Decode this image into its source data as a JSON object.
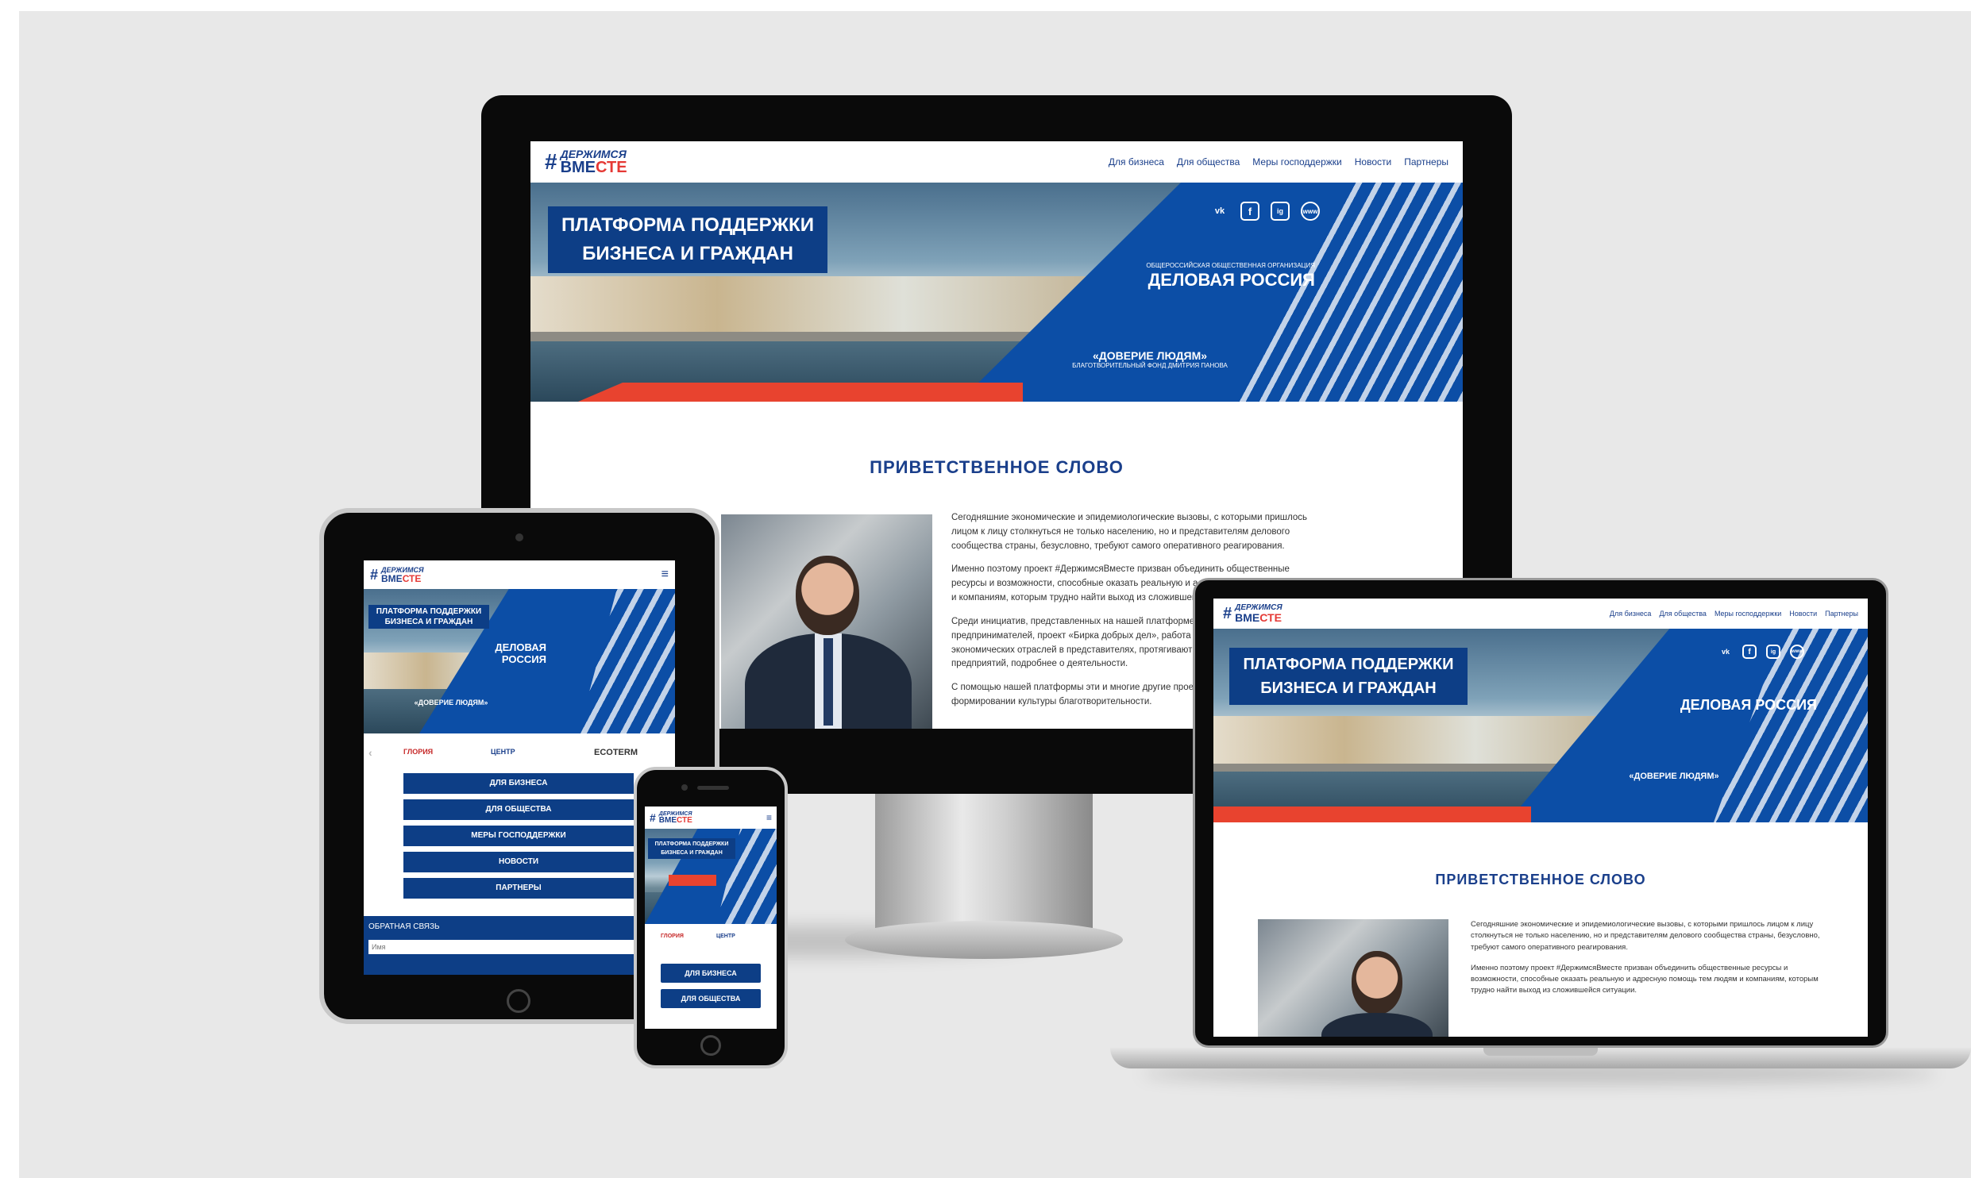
{
  "site": {
    "logo_line1": "ДЕРЖИМСЯ",
    "logo_line2a": "ВМЕ",
    "logo_line2b": "СТЕ",
    "logo_hash": "#",
    "nav": [
      "Для бизнеса",
      "Для общества",
      "Меры господдержки",
      "Новости",
      "Партнеры"
    ]
  },
  "banner": {
    "title_line1": "ПЛАТФОРМА ПОДДЕРЖКИ",
    "title_line2": "БИЗНЕСА И ГРАЖДАН",
    "org1_small": "ОБЩЕРОССИЙСКАЯ ОБЩЕСТВЕННАЯ ОРГАНИЗАЦИЯ",
    "org1_big": "ДЕЛОВАЯ РОССИЯ",
    "org2_big": "«ДОВЕРИЕ ЛЮДЯМ»",
    "org2_small": "БЛАГОТВОРИТЕЛЬНЫЙ ФОНД ДМИТРИЯ ПАНОВА",
    "social": [
      "vk",
      "f",
      "ig",
      "www"
    ],
    "social_icon_names": [
      "vk-icon",
      "facebook-icon",
      "instagram-icon",
      "globe-icon"
    ]
  },
  "welcome": {
    "heading": "ПРИВЕТСТВЕННОЕ СЛОВО",
    "p1": "Сегодняшние экономические и эпидемиологические вызовы, с которыми пришлось лицом к лицу столкнуться не только населению, но и представителям делового сообщества страны, безусловно, требуют самого оперативного реагирования.",
    "p2": "Именно поэтому проект #ДержимсяВместе призван объединить общественные ресурсы и возможности, способные оказать реальную и адресную помощь тем людям и компаниям, которым трудно найти выход из сложившейся ситуации.",
    "p3": "Среди инициатив, представленных на нашей платформе – программы поддержки предпринимателей, проект «Бирка добрых дел», работа наиболее пострадавших экономических отраслей в представителях, протягивают руку помощи работникам предприятий, подробнее о деятельности.",
    "p4": "С помощью нашей платформы эти и многие другие проекты станут инструментом в формировании культуры благотворительности."
  },
  "mobile": {
    "menu": [
      "ДЛЯ БИЗНЕСА",
      "ДЛЯ ОБЩЕСТВА",
      "МЕРЫ ГОСПОДДЕРЖКИ",
      "НОВОСТИ",
      "ПАРТНЕРЫ"
    ],
    "feedback_label": "ОБРАТНАЯ СВЯЗЬ",
    "feedback_placeholder": "Имя",
    "partner_logos": [
      "ГЛОРИЯ",
      "ЦЕНТР",
      "ECOTERM"
    ],
    "phone_buttons": [
      "ДЛЯ БИЗНЕСА",
      "ДЛЯ ОБЩЕСТВА"
    ]
  },
  "colors": {
    "brand_blue": "#1a3f8b",
    "banner_blue": "#0c4ea6",
    "accent_red": "#e53935",
    "backdrop": "#e8e8e8"
  }
}
